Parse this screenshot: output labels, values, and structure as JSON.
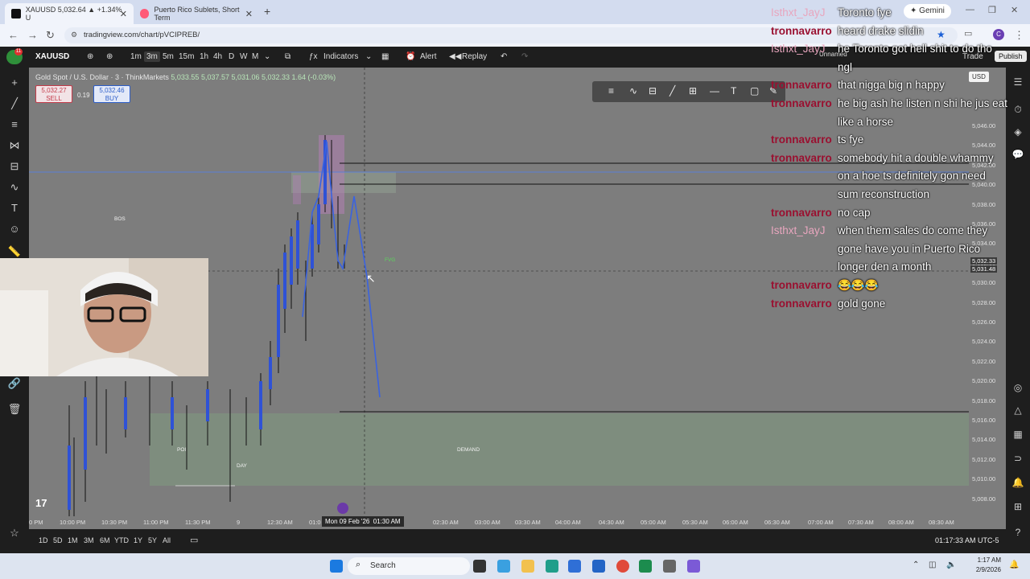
{
  "browser": {
    "tabs": [
      {
        "title": "XAUUSD 5,032.64 ▲ +1.34% U",
        "active": true
      },
      {
        "title": "Puerto Rico Sublets, Short Term",
        "active": false
      }
    ],
    "new_tab": "+",
    "gemini": "Gemini",
    "url": "tradingview.com/chart/pVCIPREB/",
    "account_initial": "C"
  },
  "tv": {
    "symbol": "XAUUSD",
    "intervals": [
      "1m",
      "3m",
      "5m",
      "15m",
      "1h",
      "4h",
      "D",
      "W",
      "M"
    ],
    "active_interval": "3m",
    "indicators_label": "Indicators",
    "alert_label": "Alert",
    "replay_label": "Replay",
    "trade_label": "Trade",
    "publish_label": "Publish",
    "unnamed_label": "Unnamed"
  },
  "chart": {
    "legend_title": "Gold Spot / U.S. Dollar · 3 · ThinkMarkets",
    "ohlc": "5,033.55  5,037.57  5,031.06  5,032.33  1.64 (-0.03%)",
    "sell_price": "5,032.27",
    "sell_label": "SELL",
    "buy_price": "5,032.46",
    "buy_label": "BUY",
    "spread": "0.19",
    "currency": "USD",
    "price_ticks": [
      "5,046.00",
      "5,044.00",
      "5,042.00",
      "5,040.00",
      "5,038.00",
      "5,036.00",
      "5,034.00",
      "5,032.00",
      "5,030.00",
      "5,028.00",
      "5,026.00",
      "5,024.00",
      "5,022.00",
      "5,020.00",
      "5,018.00",
      "5,016.00",
      "5,014.00",
      "5,012.00",
      "5,010.00",
      "5,008.00"
    ],
    "price_label_a": "5,032.33",
    "price_label_b": "5,031.48",
    "time_ticks": [
      "0 PM",
      "10:00 PM",
      "10:30 PM",
      "11:00 PM",
      "11:30 PM",
      "9",
      "12:30 AM",
      "01:0",
      "02:30 AM",
      "03:00 AM",
      "03:30 AM",
      "04:00 AM",
      "04:30 AM",
      "05:00 AM",
      "05:30 AM",
      "06:00 AM",
      "06:30 AM",
      "07:00 AM",
      "07:30 AM",
      "08:00 AM",
      "08:30 AM"
    ],
    "cursor_date": "Mon 09 Feb '26",
    "cursor_time": "01:30 AM",
    "zone_labels": {
      "bos": "BOS",
      "fvg": "FVG",
      "demand": "DEMAND",
      "poi": "POI",
      "day": "DAY"
    },
    "tv_logo": "17"
  },
  "chat": [
    {
      "user": "Isthxt_JayJ",
      "msg": "Toronto fye",
      "pink": true
    },
    {
      "user": "tronnavarro",
      "msg": "heard drake slidin",
      "pink": false
    },
    {
      "user": "Isthxt_JayJ",
      "msg": "he Toronto got hell shit to do tho",
      "pink": true
    },
    {
      "user": "",
      "msg": "ngl",
      "pink": false
    },
    {
      "user": "tronnavarro",
      "msg": "that nigga big n happy",
      "pink": false
    },
    {
      "user": "tronnavarro",
      "msg": "he big ash he listen n shi he jus eat",
      "pink": false
    },
    {
      "user": "",
      "msg": "like a horse",
      "pink": false
    },
    {
      "user": "tronnavarro",
      "msg": "ts fye",
      "pink": false
    },
    {
      "user": "tronnavarro",
      "msg": "somebody hit a double whammy",
      "pink": false
    },
    {
      "user": "",
      "msg": "on a hoe ts definitely gon need",
      "pink": false
    },
    {
      "user": "",
      "msg": "sum reconstruction",
      "pink": false
    },
    {
      "user": "tronnavarro",
      "msg": "no cap",
      "pink": false
    },
    {
      "user": "Isthxt_JayJ",
      "msg": "when them sales do come they",
      "pink": true
    },
    {
      "user": "",
      "msg": "gone have you in Puerto Rico",
      "pink": false
    },
    {
      "user": "",
      "msg": "longer den a month",
      "pink": false
    },
    {
      "user": "tronnavarro",
      "msg": "😂😂😂",
      "pink": false
    },
    {
      "user": "tronnavarro",
      "msg": "gold gone",
      "pink": false
    }
  ],
  "bottom": {
    "ranges": [
      "1D",
      "5D",
      "1M",
      "3M",
      "6M",
      "YTD",
      "1Y",
      "5Y",
      "All"
    ],
    "clock": "01:17:33 AM UTC-5"
  },
  "taskbar": {
    "search_label": "Search",
    "time": "1:17 AM",
    "date": "2/9/2026"
  }
}
